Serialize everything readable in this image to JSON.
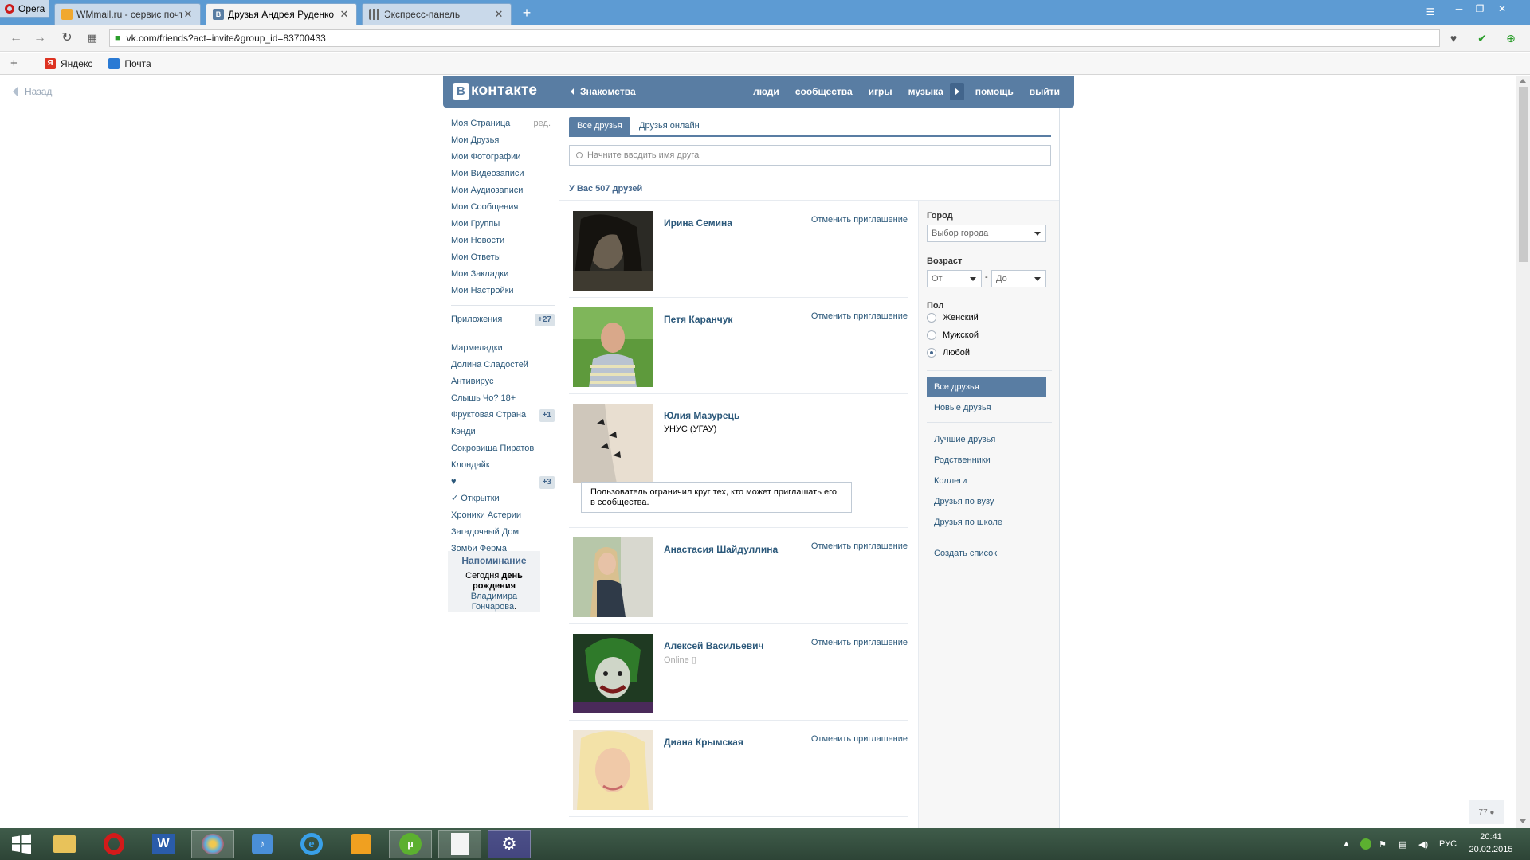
{
  "browser": {
    "app_name": "Opera",
    "tabs": [
      {
        "title": "WMmail.ru - сервис почт"
      },
      {
        "title": "Друзья Андрея Руденко"
      },
      {
        "title": "Экспресс-панель"
      }
    ],
    "url": "vk.com/friends?act=invite&group_id=83700433",
    "bookmarks": [
      "Яндекс",
      "Почта"
    ]
  },
  "page": {
    "back_label": "Назад",
    "logo_text": "контакте",
    "logo_letter": "В",
    "dating_label": "Знакомства",
    "nav": [
      "люди",
      "сообщества",
      "игры",
      "музыка",
      "помощь",
      "выйти"
    ]
  },
  "side_menu": {
    "edit_label": "ред.",
    "main": [
      "Моя Страница",
      "Мои Друзья",
      "Мои Фотографии",
      "Мои Видеозаписи",
      "Мои Аудиозаписи",
      "Мои Сообщения",
      "Мои Группы",
      "Мои Новости",
      "Мои Ответы",
      "Мои Закладки",
      "Мои Настройки"
    ],
    "apps_label": "Приложения",
    "apps_count": "+27",
    "apps": [
      {
        "label": "Мармеладки",
        "count": ""
      },
      {
        "label": "Долина Сладостей",
        "count": ""
      },
      {
        "label": "Антивирус",
        "count": ""
      },
      {
        "label": "Слышь Чо? 18+",
        "count": ""
      },
      {
        "label": "Фруктовая Страна",
        "count": "+1"
      },
      {
        "label": "Кэнди",
        "count": ""
      },
      {
        "label": "Сокровища Пиратов",
        "count": ""
      },
      {
        "label": "Клондайк",
        "count": ""
      },
      {
        "label": "♥",
        "count": "+3"
      },
      {
        "label": "✓ Открытки",
        "count": ""
      },
      {
        "label": "Хроники Астерии",
        "count": ""
      },
      {
        "label": "Загадочный Дом",
        "count": ""
      },
      {
        "label": "Зомби Ферма",
        "count": ""
      }
    ],
    "reminder": {
      "title": "Напоминание",
      "text_1": "Сегодня",
      "text_bold": "день рождения",
      "name": "Владимира Гончарова",
      "dot": "."
    }
  },
  "friends_page": {
    "tab_all": "Все друзья",
    "tab_online": "Друзья онлайн",
    "search_placeholder": "Начните вводить имя друга",
    "count_text": "У Вас 507 друзей",
    "friends": [
      {
        "name": "Ирина Семина",
        "sub": "",
        "action": "Отменить приглашение"
      },
      {
        "name": "Петя Каранчук",
        "sub": "",
        "action": "Отменить приглашение"
      },
      {
        "name": "Юлия Мазурець",
        "sub": "УНУС (УГАУ)",
        "action": "",
        "notice": "Пользователь ограничил круг тех, кто может приглашать его в сообщества."
      },
      {
        "name": "Анастасия Шайдуллина",
        "sub": "",
        "action": "Отменить приглашение"
      },
      {
        "name": "Алексей Васильевич",
        "sub": "Online",
        "action": "Отменить приглашение"
      },
      {
        "name": "Диана Крымская",
        "sub": "",
        "action": "Отменить приглашение"
      }
    ]
  },
  "filters": {
    "city_label": "Город",
    "city_placeholder": "Выбор города",
    "age_label": "Возраст",
    "age_from": "От",
    "age_dash": "-",
    "age_to": "До",
    "sex_label": "Пол",
    "sex_options": [
      "Женский",
      "Мужской",
      "Любой"
    ],
    "sex_selected": "Любой",
    "lists_1": [
      "Все друзья",
      "Новые друзья"
    ],
    "lists_2": [
      "Лучшие друзья",
      "Родственники",
      "Коллеги",
      "Друзья по вузу",
      "Друзья по школе"
    ],
    "create_list": "Создать список"
  },
  "online_counter": "77",
  "taskbar": {
    "lang": "РУС",
    "time": "20:41",
    "date": "20.02.2015"
  },
  "colors": {
    "vk_blue": "#597da3",
    "link": "#2b587a",
    "titlebar": "#5d9bd3"
  }
}
